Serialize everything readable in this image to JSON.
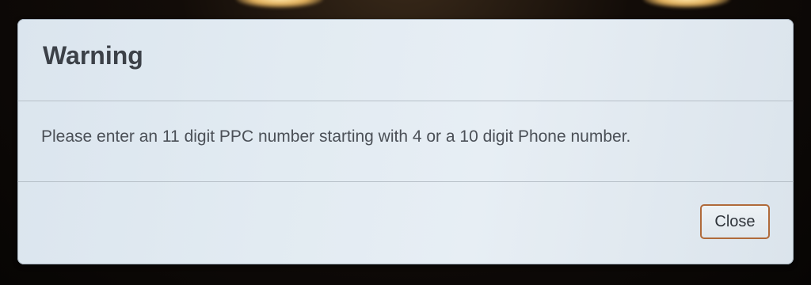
{
  "dialog": {
    "title": "Warning",
    "message": "Please enter an 11 digit PPC number starting with 4 or a 10 digit Phone number.",
    "close_label": "Close"
  }
}
